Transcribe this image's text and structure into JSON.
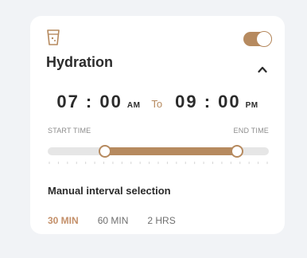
{
  "card": {
    "icon": "water-glass-icon",
    "title": "Hydration",
    "toggle_on": true,
    "collapse_icon": "chevron-up-icon"
  },
  "time_range": {
    "start_time": "07 : 00",
    "start_period": "AM",
    "separator": "To",
    "end_time": "09 : 00",
    "end_period": "PM",
    "start_label": "START TIME",
    "end_label": "END TIME"
  },
  "interval": {
    "heading": "Manual interval selection",
    "options": [
      "30 MIN",
      "60 MIN",
      "2 HRS"
    ],
    "selected": "30 MIN"
  },
  "colors": {
    "accent": "#b68a5f",
    "selected_option": "#c4906a",
    "track": "#e6e6e6"
  }
}
